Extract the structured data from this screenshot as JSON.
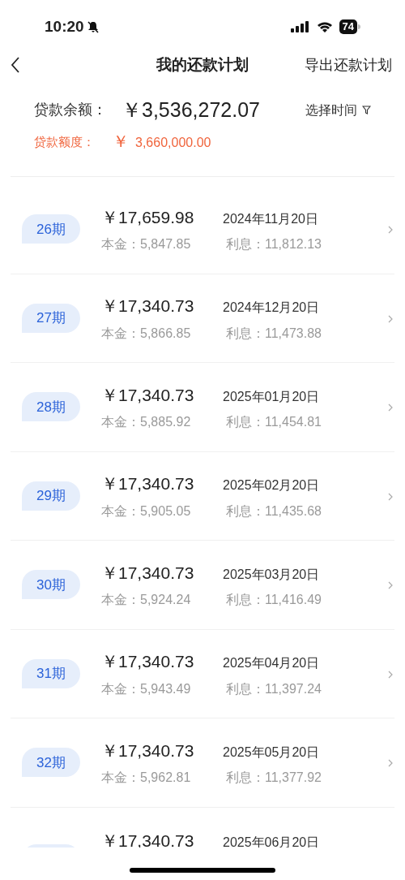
{
  "status_bar": {
    "time": "10:20",
    "battery": "74"
  },
  "nav": {
    "title": "我的还款计划",
    "action": "导出还款计划"
  },
  "summary": {
    "balance_label": "贷款余额：",
    "balance": "￥3,536,272.07",
    "filter": "选择时间",
    "limit_label": "贷款额度：",
    "limit_currency": "￥",
    "limit": "3,660,000.00"
  },
  "installments": [
    {
      "period": "26期",
      "amount": "￥17,659.98",
      "date": "2024年11月20日",
      "principal": "本金：5,847.85",
      "interest": "利息：11,812.13"
    },
    {
      "period": "27期",
      "amount": "￥17,340.73",
      "date": "2024年12月20日",
      "principal": "本金：5,866.85",
      "interest": "利息：11,473.88"
    },
    {
      "period": "28期",
      "amount": "￥17,340.73",
      "date": "2025年01月20日",
      "principal": "本金：5,885.92",
      "interest": "利息：11,454.81"
    },
    {
      "period": "29期",
      "amount": "￥17,340.73",
      "date": "2025年02月20日",
      "principal": "本金：5,905.05",
      "interest": "利息：11,435.68"
    },
    {
      "period": "30期",
      "amount": "￥17,340.73",
      "date": "2025年03月20日",
      "principal": "本金：5,924.24",
      "interest": "利息：11,416.49"
    },
    {
      "period": "31期",
      "amount": "￥17,340.73",
      "date": "2025年04月20日",
      "principal": "本金：5,943.49",
      "interest": "利息：11,397.24"
    },
    {
      "period": "32期",
      "amount": "￥17,340.73",
      "date": "2025年05月20日",
      "principal": "本金：5,962.81",
      "interest": "利息：11,377.92"
    },
    {
      "amount": "￥17,340.73",
      "date": "2025年06月20日"
    }
  ]
}
